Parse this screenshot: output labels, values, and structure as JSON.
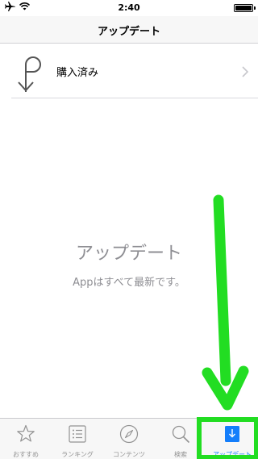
{
  "status_bar": {
    "time": "2:40",
    "icons": [
      "airplane-icon",
      "wifi-icon",
      "battery-icon"
    ]
  },
  "nav": {
    "title": "アップデート"
  },
  "purchased": {
    "label": "購入済み",
    "icon": "purchased-icon"
  },
  "empty_state": {
    "title": "アップデート",
    "message": "Appはすべて最新です。"
  },
  "tab_bar": {
    "items": [
      {
        "label": "おすすめ",
        "icon": "star-icon"
      },
      {
        "label": "ランキング",
        "icon": "list-icon"
      },
      {
        "label": "コンテンツ",
        "icon": "compass-icon"
      },
      {
        "label": "検索",
        "icon": "search-icon"
      },
      {
        "label": "アップデート",
        "icon": "update-icon"
      }
    ],
    "active_index": 4
  },
  "colors": {
    "accent": "#147efb",
    "annotation": "#22dd22",
    "muted_text": "#8e8e93"
  }
}
